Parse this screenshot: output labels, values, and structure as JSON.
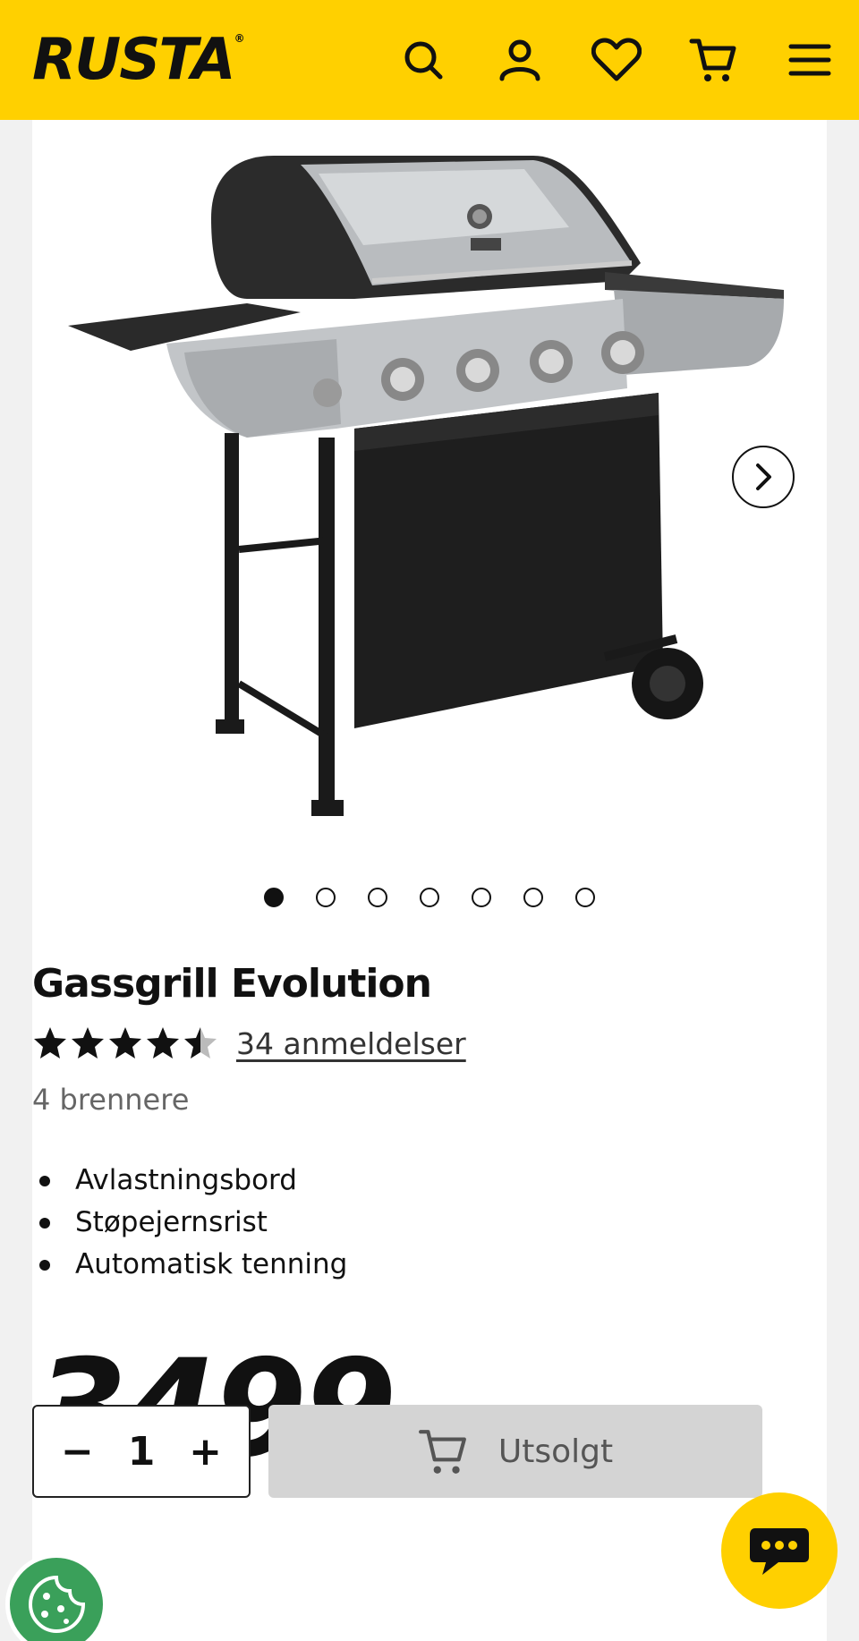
{
  "header": {
    "logo_text": "RUSTA",
    "logo_mark": "®",
    "brand_color": "#ffd000",
    "icons": [
      "search-icon",
      "account-icon",
      "heart-icon",
      "cart-icon",
      "menu-icon"
    ]
  },
  "gallery": {
    "image_alt": "product-image-gas-grill",
    "image_count": 7,
    "active_index": 0,
    "next_icon": "chevron-right-icon"
  },
  "product": {
    "title": "Gassgrill Evolution",
    "rating": 4.5,
    "rating_max": 5,
    "reviews_label": "34 anmeldelser",
    "subtitle": "4 brennere",
    "features": [
      "Avlastningsbord",
      "Støpejernsrist",
      "Automatisk tenning"
    ],
    "price": "3499",
    "price_suffix": ",-"
  },
  "purchase": {
    "qty_minus": "−",
    "qty_value": "1",
    "qty_plus": "+",
    "button_label": "Utsolgt",
    "button_icon": "cart-icon"
  },
  "widgets": {
    "chat_icon": "chat-bubble-icon",
    "cookie_icon": "cookie-icon"
  }
}
